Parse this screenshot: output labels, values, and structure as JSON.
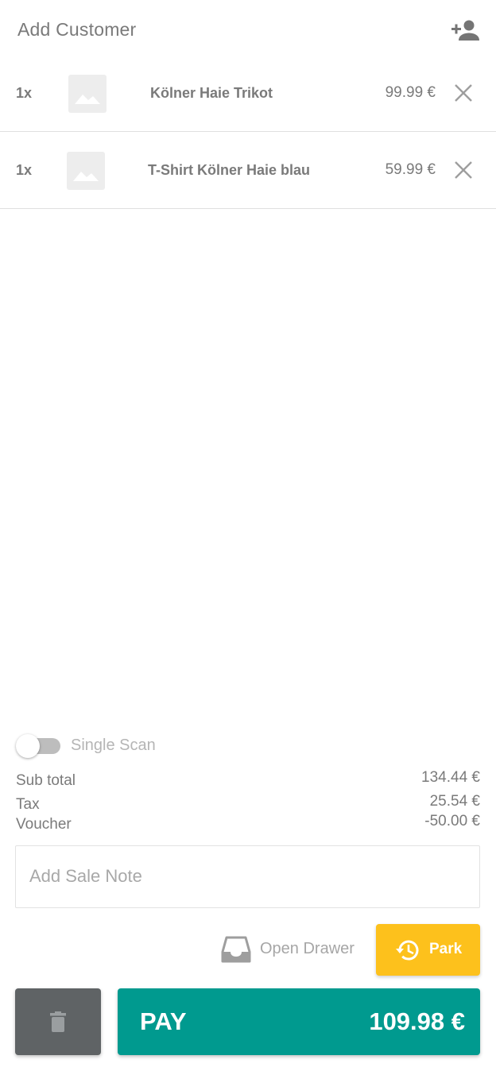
{
  "header": {
    "title": "Add Customer",
    "add_customer_icon": "person-add-icon"
  },
  "cart": {
    "items": [
      {
        "qty": "1x",
        "name": "Kölner Haie Trikot",
        "price": "99.99 €",
        "thumbnail_icon": "image-placeholder-icon",
        "remove_icon": "close-icon"
      },
      {
        "qty": "1x",
        "name": "T-Shirt Kölner Haie blau",
        "price": "59.99 €",
        "thumbnail_icon": "image-placeholder-icon",
        "remove_icon": "close-icon"
      }
    ]
  },
  "single_scan": {
    "label": "Single Scan",
    "enabled": false
  },
  "summary": {
    "subtotal_label": "Sub total",
    "subtotal_value": "134.44 €",
    "tax_label": "Tax",
    "tax_value": "25.54 €",
    "voucher_label": "Voucher",
    "voucher_value": "-50.00 €"
  },
  "sale_note": {
    "placeholder": "Add Sale Note",
    "value": ""
  },
  "actions": {
    "open_drawer_label": "Open Drawer",
    "open_drawer_icon": "inbox-tray-icon",
    "park_label": "Park",
    "park_icon": "history-icon",
    "trash_icon": "trash-icon",
    "pay_label": "PAY",
    "pay_amount": "109.98 €"
  },
  "colors": {
    "pay": "#009a8f",
    "park": "#fdc11c",
    "trash": "#5f6365",
    "text": "#7a7a7a"
  }
}
